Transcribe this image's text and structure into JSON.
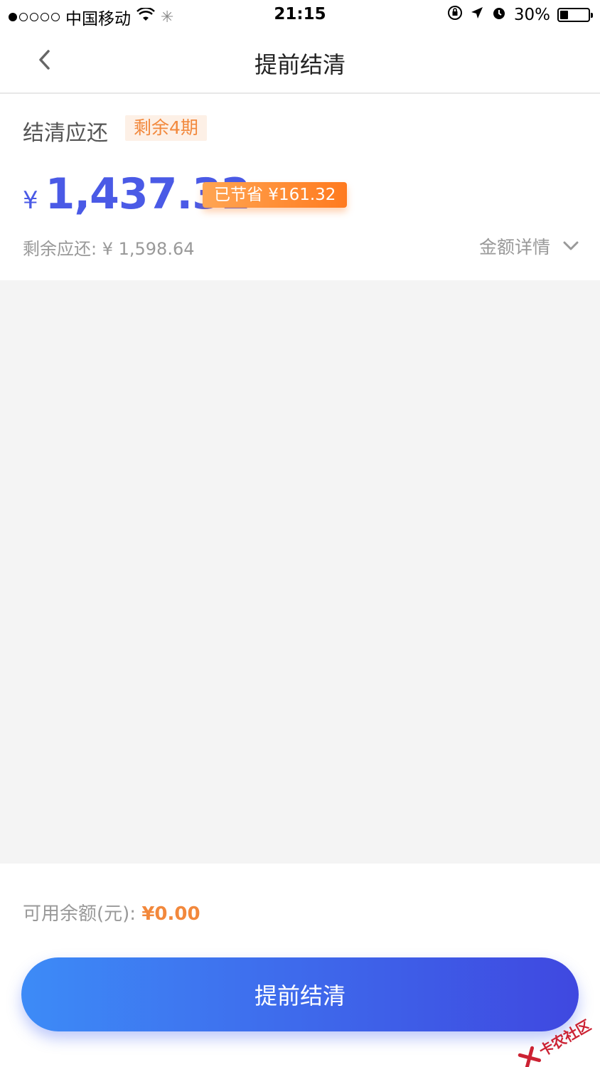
{
  "status_bar": {
    "carrier": "中国移动",
    "time": "21:15",
    "battery": "30%",
    "battery_level": 0.3
  },
  "nav": {
    "title": "提前结清",
    "back_icon": "chevron-left-icon"
  },
  "summary": {
    "label": "结清应还",
    "periods_badge": "剩余4期",
    "currency": "¥",
    "amount": "1,437.32",
    "saved_badge": "已节省 ¥161.32",
    "remaining": "剩余应还: ¥ 1,598.64",
    "detail_link": "金额详情"
  },
  "footer": {
    "balance_label": "可用余额(元): ",
    "balance_value": "¥0.00",
    "button_label": "提前结清"
  },
  "watermark": {
    "text": "卡农社区"
  },
  "colors": {
    "accent_blue": "#4a5ae6",
    "accent_orange": "#f2883c",
    "button_gradient_start": "#3d8bf7",
    "button_gradient_end": "#3f48e0"
  }
}
